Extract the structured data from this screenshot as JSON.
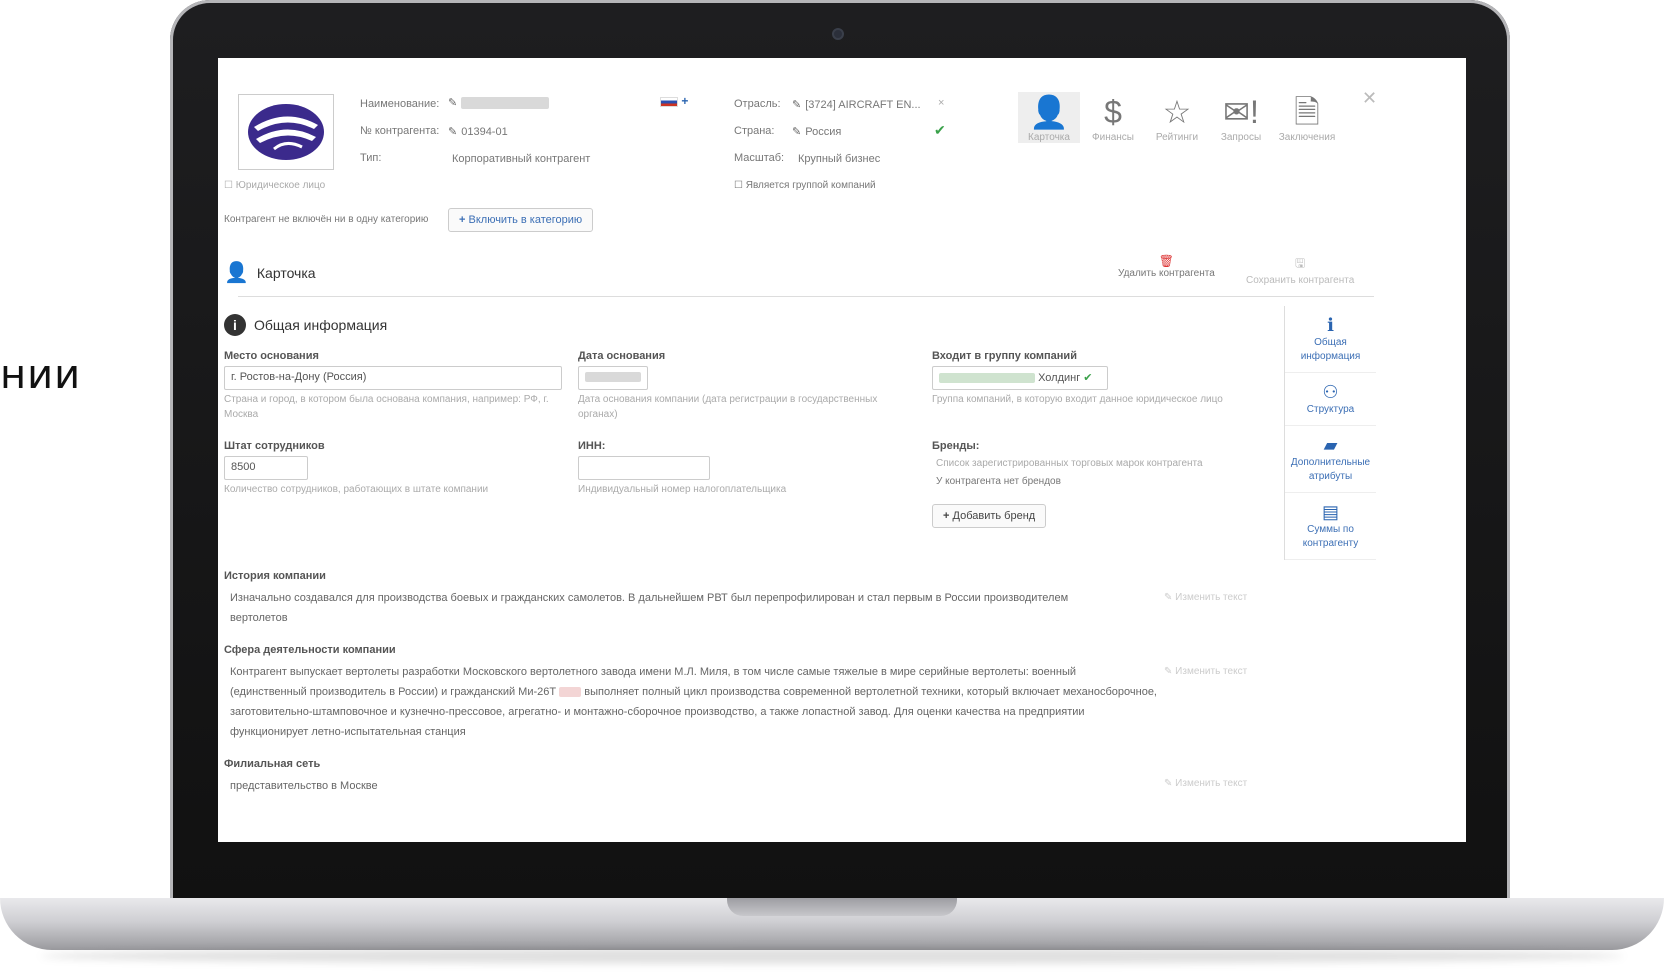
{
  "left_fragment": "нии",
  "header": {
    "name_label": "Наименование:",
    "number_label": "№ контрагента:",
    "number_value": "01394-01",
    "type_label": "Тип:",
    "type_value": "Корпоративный контрагент",
    "legal_entity": "Юридическое лицо",
    "industry_label": "Отрасль:",
    "industry_value": "[3724] AIRCRAFT EN...",
    "country_label": "Страна:",
    "country_value": "Россия",
    "scale_label": "Масштаб:",
    "scale_value": "Крупный бизнес",
    "is_group": "Является группой компаний",
    "categories_note": "Контрагент не включён ни в одну категорию",
    "include_category": "Включить в категорию"
  },
  "top_nav": [
    {
      "label": "Карточка",
      "icon": "user-icon",
      "glyph": "👤"
    },
    {
      "label": "Финансы",
      "icon": "dollar-icon",
      "glyph": "$"
    },
    {
      "label": "Рейтинги",
      "icon": "star-icon",
      "glyph": "☆"
    },
    {
      "label": "Запросы",
      "icon": "envelope-icon",
      "glyph": "✉!"
    },
    {
      "label": "Заключения",
      "icon": "document-icon",
      "glyph": "🗎"
    }
  ],
  "card": {
    "title": "Карточка",
    "delete": "Удалить контрагента",
    "save": "Сохранить контрагента"
  },
  "general": {
    "title": "Общая информация",
    "place_label": "Место основания",
    "place_value": "г. Ростов-на-Дону (Россия)",
    "place_help": "Страна и город, в котором была основана компания, например: РФ, г. Москва",
    "date_label": "Дата основания",
    "date_help": "Дата основания компании (дата регистрации в государственных органах)",
    "group_label": "Входит в группу компаний",
    "group_value": "Холдинг",
    "group_help": "Группа компаний, в которую входит данное юридическое лицо",
    "staff_label": "Штат сотрудников",
    "staff_value": "8500",
    "staff_help": "Количество сотрудников, работающих в штате компании",
    "inn_label": "ИНН:",
    "inn_help": "Индивидуальный номер налогоплательщика",
    "brands_label": "Бренды:",
    "brands_help": "Список зарегистрированных торговых марок контрагента",
    "brands_none": "У контрагента нет брендов",
    "add_brand": "Добавить бренд"
  },
  "side_nav": [
    {
      "label": "Общая информация",
      "glyph": "ℹ"
    },
    {
      "label": "Структура",
      "glyph": "⚇"
    },
    {
      "label": "Дополнительные атрибуты",
      "glyph": "▰"
    },
    {
      "label": "Суммы по контрагенту",
      "glyph": "▤"
    }
  ],
  "history": {
    "title": "История компании",
    "text1": "Изначально создавался для производства боевых и гражданских самолетов. В дальнейшем РВТ был перепрофилирован и стал первым в России производителем",
    "text2": "вертолетов",
    "edit": "Изменить текст"
  },
  "activity": {
    "title": "Сфера деятельности компании",
    "line1": "Контрагент выпускает вертолеты разработки Московского вертолетного завода имени М.Л. Миля, в том числе самые тяжелые в мире серийные вертолеты: военный",
    "line2": "(единственный производитель в России) и гражданский Ми-26Т",
    "line2b": "выполняет полный цикл производства современной вертолетной техники, который включает механосборочное,",
    "line3": "заготовительно-штамповочное и кузнечно-прессовое, агрегатно- и монтажно-сборочное производство, а также лопастной завод. Для оценки качества на предприятии",
    "line4": "функционирует летно-испытательная станция",
    "edit": "Изменить текст"
  },
  "branches": {
    "title": "Филиальная сеть",
    "text": "представительство в Москве",
    "edit": "Изменить текст"
  }
}
